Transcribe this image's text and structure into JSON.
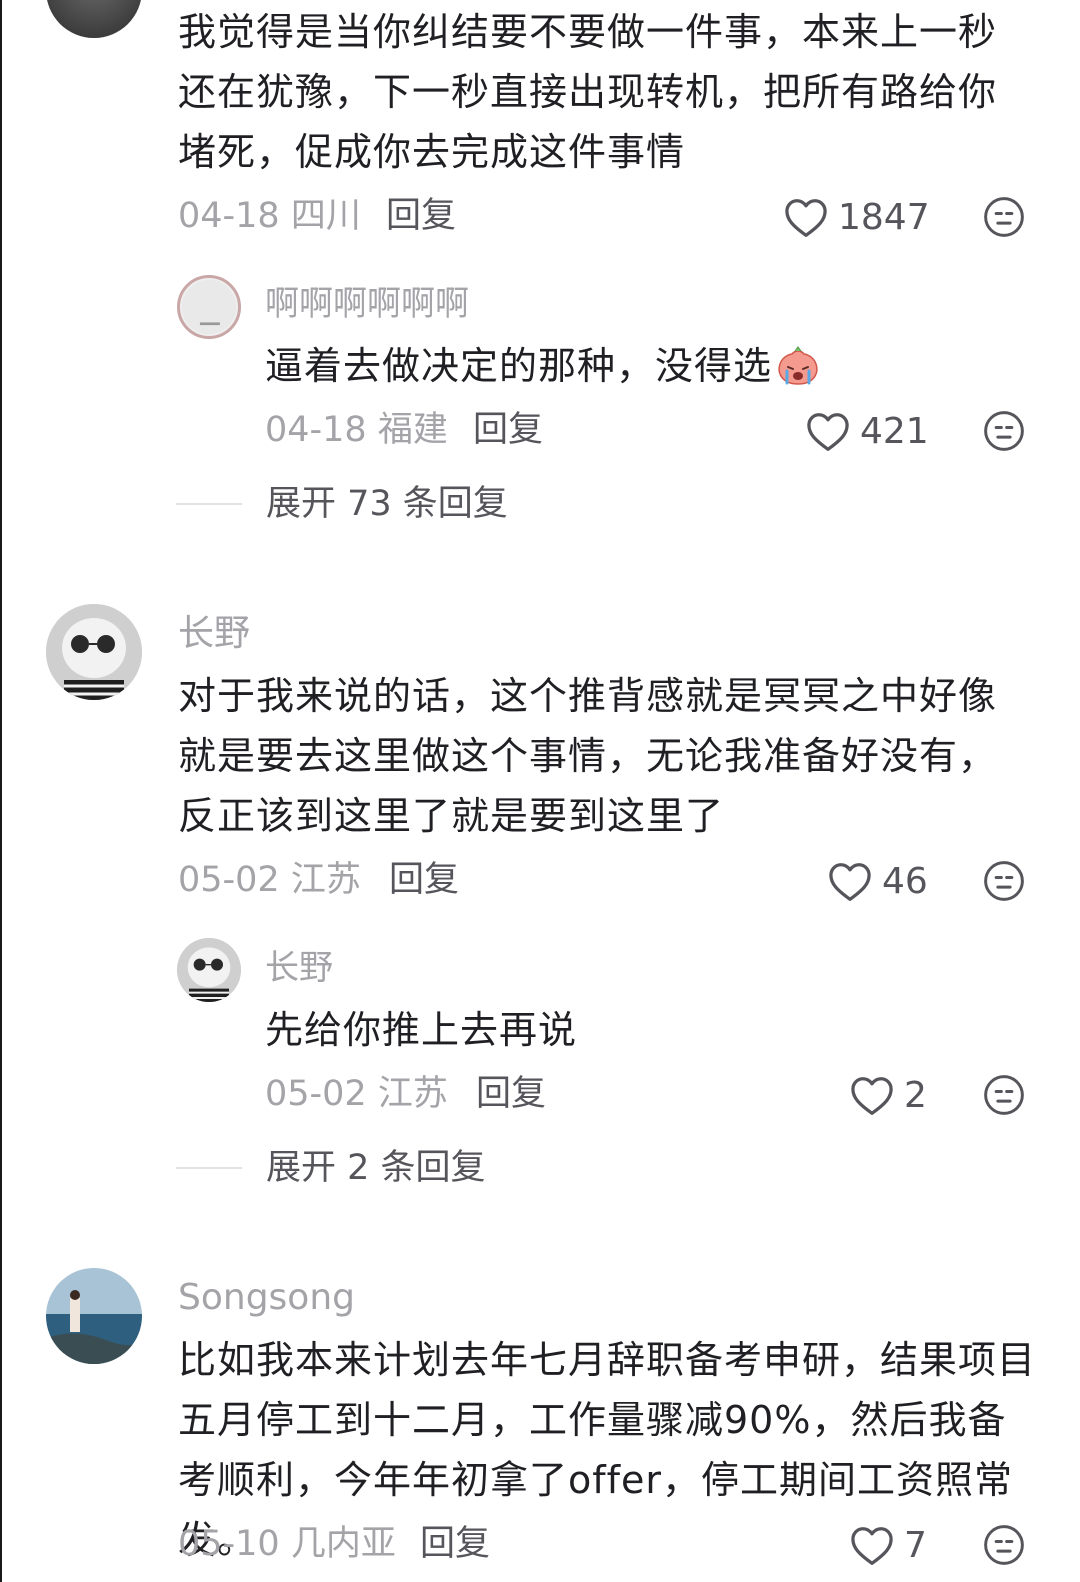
{
  "comments": [
    {
      "text": "我觉得是当你纠结要不要做一件事，本来上一秒还在犹豫，下一秒直接出现转机，把所有路给你堵死，促成你去完成这件事情",
      "date": "04-18",
      "location": "四川",
      "reply_label": "回复",
      "likes": "1847",
      "replies": [
        {
          "username": "啊啊啊啊啊啊",
          "text": "逼着去做决定的那种，没得选",
          "emoji": "crying-face-emoji",
          "date": "04-18",
          "location": "福建",
          "reply_label": "回复",
          "likes": "421"
        }
      ],
      "expand_label": "展开 73 条回复"
    },
    {
      "username": "长野",
      "text": "对于我来说的话，这个推背感就是冥冥之中好像就是要去这里做这个事情，无论我准备好没有，反正该到这里了就是要到这里了",
      "date": "05-02",
      "location": "江苏",
      "reply_label": "回复",
      "likes": "46",
      "replies": [
        {
          "username": "长野",
          "text": "先给你推上去再说",
          "date": "05-02",
          "location": "江苏",
          "reply_label": "回复",
          "likes": "2"
        }
      ],
      "expand_label": "展开 2 条回复"
    },
    {
      "username": "Songsong",
      "text": "比如我本来计划去年七月辞职备考申研，结果项目五月停工到十二月，工作量骤减90%，然后我备考顺利，今年年初拿了offer，停工期间工资照常发。",
      "date": "05-10",
      "location": "几内亚",
      "reply_label": "回复",
      "likes": "7"
    }
  ],
  "icons": {
    "like": "heart-outline-icon",
    "dislike": "neutral-face-icon"
  },
  "colors": {
    "text": "#1f1f24",
    "meta": "#a3a3a8",
    "action": "#55555b"
  }
}
